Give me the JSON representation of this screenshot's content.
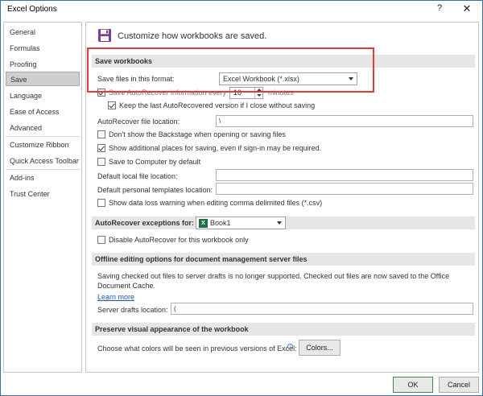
{
  "window": {
    "title": "Excel Options",
    "help_glyph": "?",
    "close_glyph": "✕"
  },
  "sidebar": {
    "items": [
      {
        "label": "General"
      },
      {
        "label": "Formulas"
      },
      {
        "label": "Proofing"
      },
      {
        "label": "Save"
      },
      {
        "label": "Language"
      },
      {
        "label": "Ease of Access"
      },
      {
        "label": "Advanced"
      },
      {
        "label": "Customize Ribbon"
      },
      {
        "label": "Quick Access Toolbar"
      },
      {
        "label": "Add-ins"
      },
      {
        "label": "Trust Center"
      }
    ],
    "active": "Save"
  },
  "header": {
    "text": "Customize how workbooks are saved."
  },
  "save_workbooks": {
    "section_title": "Save workbooks",
    "format_label": "Save files in this format:",
    "format_value": "Excel Workbook (*.xlsx)",
    "autorecover_label": "Save AutoRecover information every",
    "autorecover_minutes": "10",
    "minutes_label": "minutes",
    "keep_last_label": "Keep the last AutoRecovered version if I close without saving",
    "autorecover_location_label": "AutoRecover file location:",
    "autorecover_location_value": "                                                                                              \\",
    "dont_show_backstage_label": "Don't show the Backstage when opening or saving files",
    "show_additional_places_label": "Show additional places for saving, even if sign-in may be required.",
    "save_to_computer_label": "Save to Computer by default",
    "default_local_label": "Default local file location:",
    "default_local_value": "",
    "default_templates_label": "Default personal templates location:",
    "default_templates_value": "",
    "show_data_loss_label": "Show data loss warning when editing comma delimited files (*.csv)"
  },
  "autorecover_exceptions": {
    "section_title": "AutoRecover exceptions for:",
    "workbook_value": "Book1",
    "disable_label": "Disable AutoRecover for this workbook only"
  },
  "offline_editing": {
    "section_title": "Offline editing options for document management server files",
    "description": "Saving checked out files to server drafts is no longer supported. Checked out files are now saved to the Office Document Cache.",
    "learn_more": "Learn more",
    "server_drafts_label": "Server drafts location:",
    "server_drafts_value": "("
  },
  "preserve_visual": {
    "section_title": "Preserve visual appearance of the workbook",
    "colors_label": "Choose what colors will be seen in previous versions of Excel:",
    "info_glyph": "i",
    "colors_button": "Colors..."
  },
  "footer": {
    "ok_label": "OK",
    "cancel_label": "Cancel"
  },
  "colors": {
    "highlight": "#e03c3c",
    "accent_green": "#1e7145",
    "link": "#1a56b0"
  }
}
